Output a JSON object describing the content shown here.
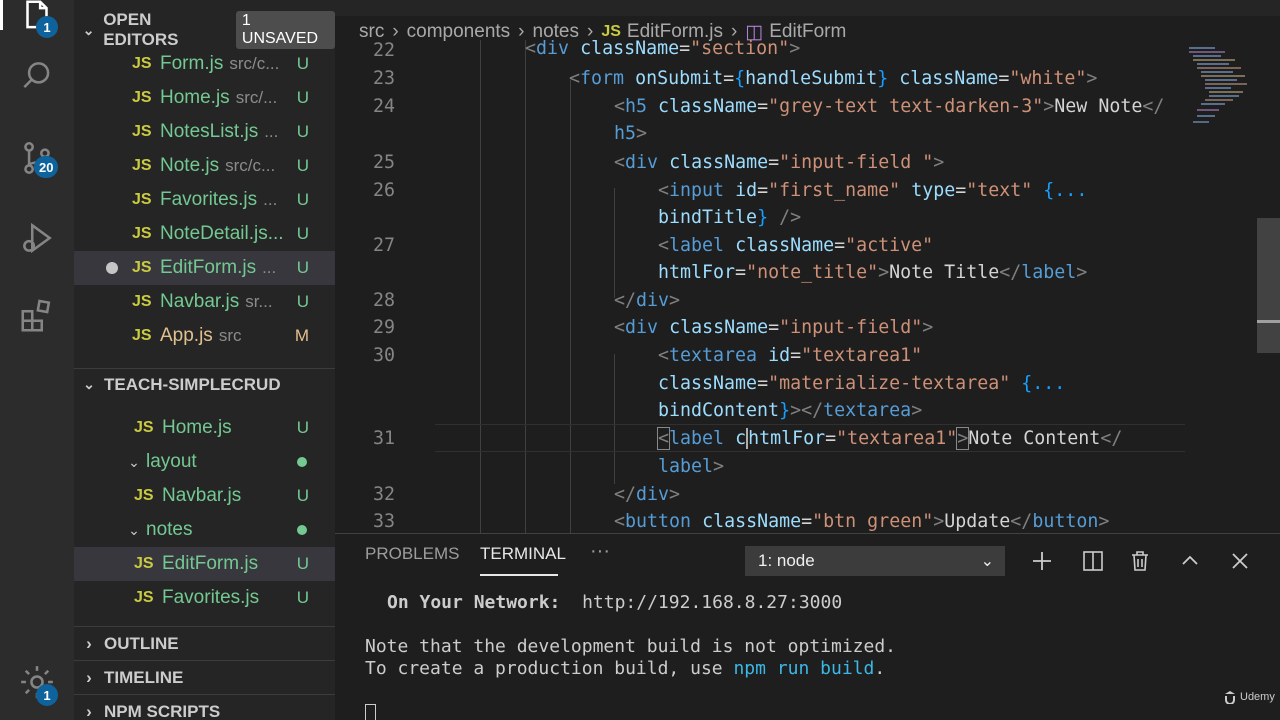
{
  "activity_bar": {
    "explorer_badge": "1",
    "scm_badge": "20",
    "settings_badge": "1"
  },
  "sidebar": {
    "open_editors_title": "OPEN EDITORS",
    "unsaved_badge": "1 UNSAVED",
    "open_editors": [
      {
        "icon": "JS",
        "name": "Form.js",
        "path": "src/c...",
        "status": "U"
      },
      {
        "icon": "JS",
        "name": "Home.js",
        "path": "src/...",
        "status": "U"
      },
      {
        "icon": "JS",
        "name": "NotesList.js",
        "path": "...",
        "status": "U"
      },
      {
        "icon": "JS",
        "name": "Note.js",
        "path": "src/c...",
        "status": "U"
      },
      {
        "icon": "JS",
        "name": "Favorites.js",
        "path": "...",
        "status": "U"
      },
      {
        "icon": "JS",
        "name": "NoteDetail.js...",
        "path": "",
        "status": "U"
      },
      {
        "icon": "JS",
        "name": "EditForm.js",
        "path": "...",
        "status": "U"
      },
      {
        "icon": "JS",
        "name": "Navbar.js",
        "path": "sr...",
        "status": "U"
      },
      {
        "icon": "JS",
        "name": "App.js",
        "path": "src",
        "status": "M"
      }
    ],
    "project_title": "TEACH-SIMPLECRUD",
    "tree": {
      "home": {
        "icon": "JS",
        "name": "Home.js",
        "status": "U"
      },
      "layout_folder": "layout",
      "navbar": {
        "icon": "JS",
        "name": "Navbar.js",
        "status": "U"
      },
      "notes_folder": "notes",
      "editform": {
        "icon": "JS",
        "name": "EditForm.js",
        "status": "U"
      },
      "favorites": {
        "icon": "JS",
        "name": "Favorites.js",
        "status": "U"
      }
    },
    "outline_title": "OUTLINE",
    "timeline_title": "TIMELINE",
    "npm_title": "NPM SCRIPTS"
  },
  "breadcrumb": {
    "parts": [
      "src",
      "components",
      "notes"
    ],
    "file": "EditForm.js",
    "file_icon": "JS",
    "symbol": "EditForm"
  },
  "editor": {
    "line_numbers": [
      "22",
      "23",
      "24",
      "25",
      "26",
      "27",
      "28",
      "29",
      "30",
      "31",
      "32",
      "33"
    ]
  },
  "panel": {
    "tabs": [
      "PROBLEMS",
      "TERMINAL",
      "···"
    ],
    "terminal_select": "1: node",
    "terminal_lines": {
      "network_label": "On Your Network:",
      "network_url": "http://192.168.8.27:3000",
      "note_line": "Note that the development build is not optimized.",
      "prod_prefix": "To create a production build, use ",
      "prod_cmd": "npm run build",
      "prod_suffix": "."
    }
  },
  "watermark": "Udemy",
  "colors": {
    "accent_badge": "#0e639c",
    "untracked_green": "#73c991",
    "modified_gold": "#e2c08d",
    "js_icon": "#cbcb41"
  }
}
